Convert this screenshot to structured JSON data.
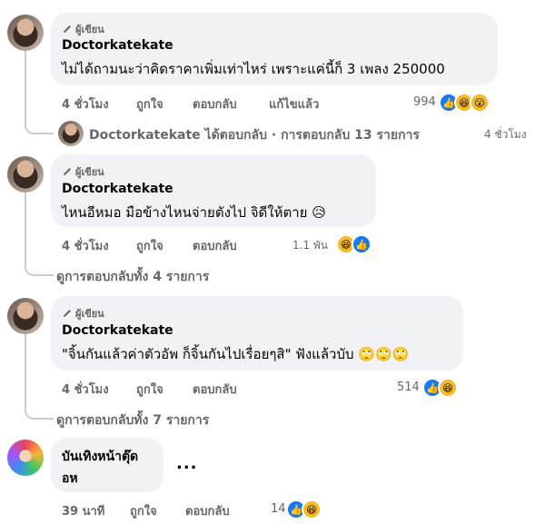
{
  "comments": [
    {
      "badge": "ผู้เขียน",
      "author": "Doctorkatekate",
      "text": "ไม่ได้ถามนะว่าคิดราคาเพิ่มเท่าไหร่ เพราะแค่นี้ก็ 3 เพลง 250000",
      "time": "4 ชั่วโมง",
      "like": "ถูกใจ",
      "reply": "ตอบกลับ",
      "edited": "แก้ไขแล้ว",
      "reactions_count": "994",
      "reply_summary": {
        "author": "Doctorkatekate",
        "action": "ได้ตอบกลับ",
        "dot": "·",
        "count_text": "การตอบกลับ 13 รายการ",
        "time": "4 ชั่วโมง"
      }
    },
    {
      "badge": "ผู้เขียน",
      "author": "Doctorkatekate",
      "text": "ไหนอีหมอ มือข้างไหนจ่ายตังไป จิดีให้ตาย",
      "time": "4 ชั่วโมง",
      "like": "ถูกใจ",
      "reply": "ตอบกลับ",
      "reactions_count": "1.1 พัน",
      "view_replies": "ดูการตอบกลับทั้ง 4 รายการ"
    },
    {
      "badge": "ผู้เขียน",
      "author": "Doctorkatekate",
      "text": "\"จิ้นกันแล้วค่าตัวอัพ ก็จิ้นกันไปเรื่อยๆสิ\" ฟังแล้วบับ",
      "time": "4 ชั่วโมง",
      "like": "ถูกใจ",
      "reply": "ตอบกลับ",
      "reactions_count": "514",
      "view_replies": "ดูการตอบกลับทั้ง 7 รายการ"
    },
    {
      "author_line1": "บันเทิงหน้าตุ๊ด",
      "author_line2": "อห",
      "more": "...",
      "time": "39 นาที",
      "like": "ถูกใจ",
      "reply": "ตอบกลับ",
      "reactions_count": "14"
    }
  ],
  "colors": {
    "bubble": "#f0f2f5",
    "meta": "#65676b",
    "like_blue": "#1877f2",
    "emoji_yellow": "#f7b928"
  }
}
